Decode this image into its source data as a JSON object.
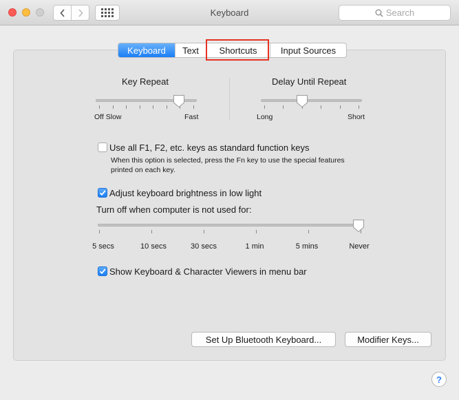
{
  "window": {
    "title": "Keyboard",
    "search_placeholder": "Search"
  },
  "tabs": [
    {
      "label": "Keyboard",
      "selected": true
    },
    {
      "label": "Text",
      "selected": false
    },
    {
      "label": "Shortcuts",
      "selected": false
    },
    {
      "label": "Input Sources",
      "selected": false
    }
  ],
  "key_repeat": {
    "label": "Key Repeat",
    "min_label": "Off Slow",
    "max_label": "Fast",
    "value": 0.86
  },
  "delay_until_repeat": {
    "label": "Delay Until Repeat",
    "min_label": "Long",
    "max_label": "Short",
    "value": 0.4
  },
  "fn_keys": {
    "label": "Use all F1, F2, etc. keys as standard function keys",
    "checked": false,
    "description": "When this option is selected, press the Fn key to use the special features printed on each key."
  },
  "brightness": {
    "label": "Adjust keyboard brightness in low light",
    "checked": true
  },
  "turn_off": {
    "label": "Turn off when computer is not used for:",
    "ticks": [
      "5 secs",
      "10 secs",
      "30 secs",
      "1 min",
      "5 mins",
      "Never"
    ],
    "value": "Never"
  },
  "viewers": {
    "label": "Show Keyboard & Character Viewers in menu bar",
    "checked": true
  },
  "buttons": {
    "bluetooth": "Set Up Bluetooth Keyboard...",
    "modifier": "Modifier Keys..."
  },
  "colors": {
    "accent": "#1b7ef6",
    "highlight_box": "#e53223"
  }
}
